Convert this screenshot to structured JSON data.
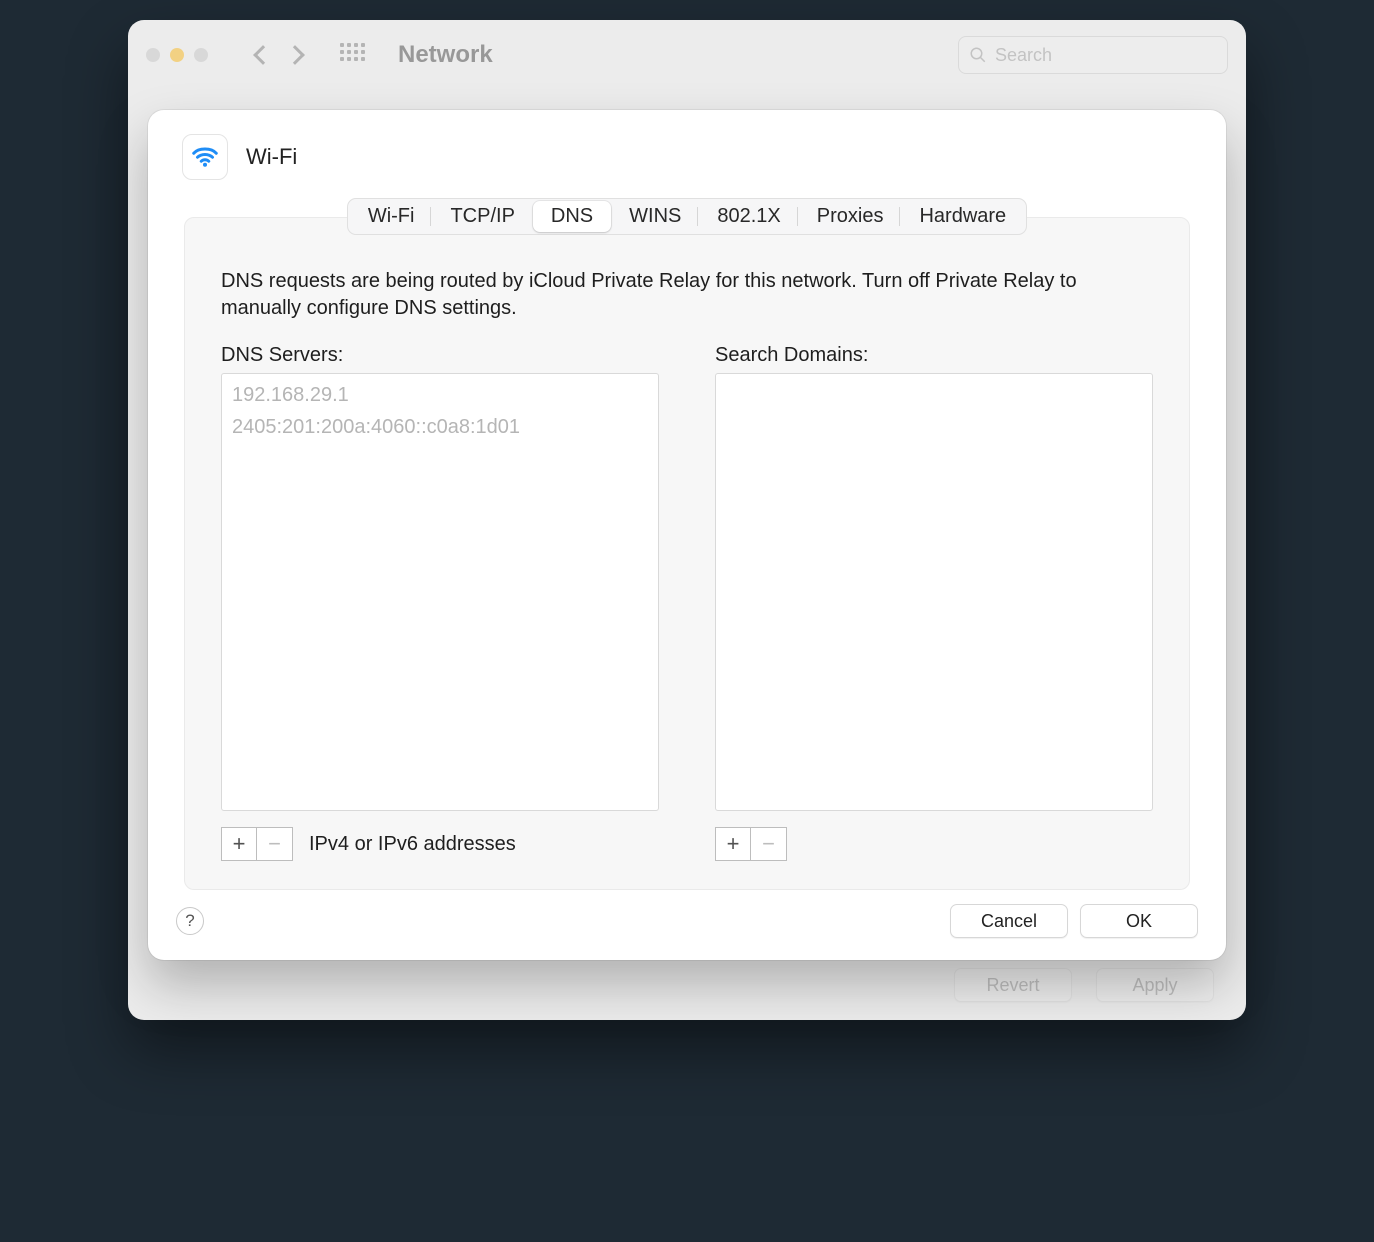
{
  "window": {
    "title": "Network"
  },
  "search": {
    "placeholder": "Search"
  },
  "sheet": {
    "title": "Wi-Fi",
    "tabs": [
      "Wi-Fi",
      "TCP/IP",
      "DNS",
      "WINS",
      "802.1X",
      "Proxies",
      "Hardware"
    ],
    "activeTab": "DNS",
    "notice": "DNS requests are being routed by iCloud Private Relay for this network. Turn off Private Relay to manually configure DNS settings.",
    "dns": {
      "label": "DNS Servers:",
      "items": [
        "192.168.29.1",
        "2405:201:200a:4060::c0a8:1d01"
      ],
      "hint": "IPv4 or IPv6 addresses"
    },
    "searchDomains": {
      "label": "Search Domains:",
      "items": []
    },
    "buttons": {
      "help": "?",
      "cancel": "Cancel",
      "ok": "OK"
    }
  },
  "windowButtons": {
    "revert": "Revert",
    "apply": "Apply"
  },
  "glyphs": {
    "plus": "+",
    "minus": "−"
  }
}
